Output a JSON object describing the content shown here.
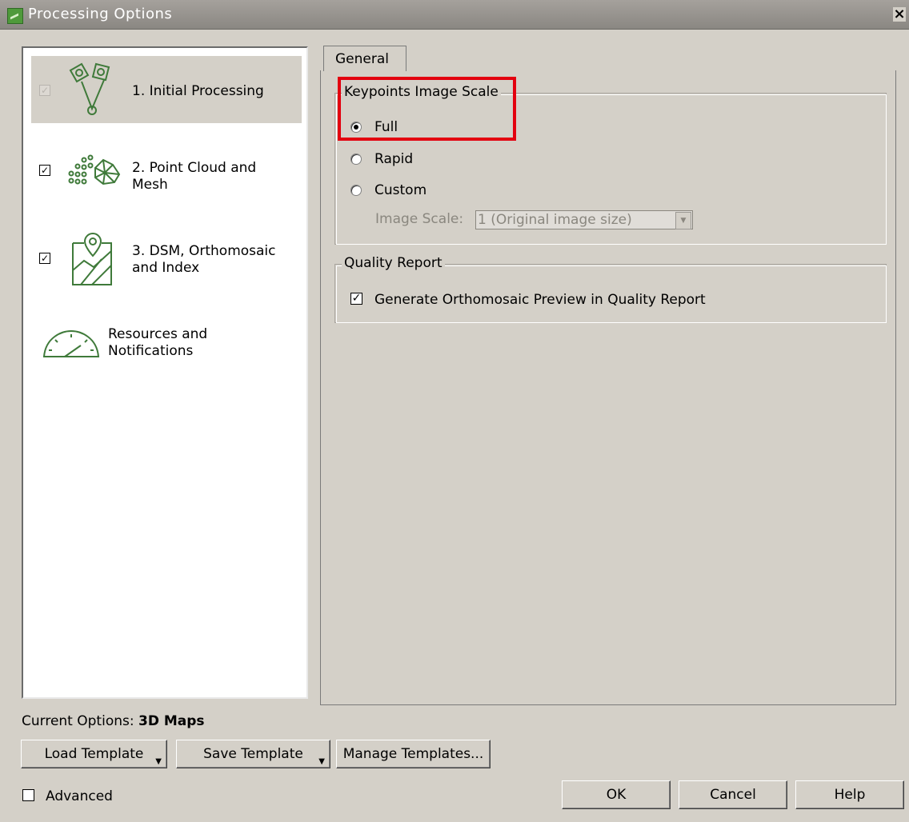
{
  "window": {
    "title": "Processing Options",
    "close_label": "×"
  },
  "sidebar": {
    "items": [
      {
        "label": "1. Initial Processing",
        "checked": true,
        "selected": true,
        "icon": "initial-processing-icon"
      },
      {
        "label": "2. Point Cloud and\nMesh",
        "checked": true,
        "selected": false,
        "icon": "point-cloud-icon"
      },
      {
        "label": "3. DSM, Orthomosaic\nand Index",
        "checked": true,
        "selected": false,
        "icon": "map-icon"
      },
      {
        "label": "Resources and\nNotifications",
        "checked": null,
        "selected": false,
        "icon": "gauge-icon"
      }
    ]
  },
  "tabs": [
    {
      "label": "General",
      "active": true
    }
  ],
  "keypoints": {
    "title": "Keypoints Image Scale",
    "options": [
      "Full",
      "Rapid",
      "Custom"
    ],
    "selected": "Full",
    "image_scale_label": "Image Scale:",
    "image_scale_value": "1 (Original image size)"
  },
  "quality_report": {
    "title": "Quality Report",
    "checkbox_label": "Generate Orthomosaic Preview in Quality Report",
    "checked": true
  },
  "footer": {
    "current_options_label": "Current Options:",
    "current_options_value": "3D Maps",
    "load_template": "Load Template",
    "save_template": "Save Template",
    "manage_templates": "Manage Templates...",
    "advanced_label": "Advanced",
    "ok": "OK",
    "cancel": "Cancel",
    "help": "Help"
  },
  "colors": {
    "accent_green": "#3f7a3a",
    "highlight_red": "#e3000f",
    "dialog_bg": "#d4d0c8"
  }
}
